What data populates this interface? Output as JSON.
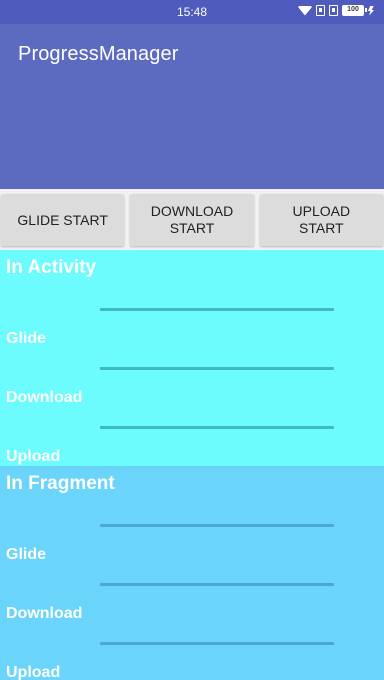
{
  "status_bar": {
    "time": "15:48",
    "battery": "100"
  },
  "app_bar": {
    "title": "ProgressManager"
  },
  "buttons": {
    "glide": "GLIDE START",
    "download": "DOWNLOAD\nSTART",
    "upload": "UPLOAD\nSTART"
  },
  "activity": {
    "title": "In Activity",
    "rows": [
      {
        "label": "Glide",
        "progress": 0
      },
      {
        "label": "Download",
        "progress": 0
      },
      {
        "label": "Upload",
        "progress": 0
      }
    ]
  },
  "fragment": {
    "title": "In Fragment",
    "rows": [
      {
        "label": "Glide",
        "progress": 0
      },
      {
        "label": "Download",
        "progress": 0
      },
      {
        "label": "Upload",
        "progress": 0
      }
    ]
  },
  "colors": {
    "app_bar": "#5c6bc0",
    "status_bar": "#4f5bbd",
    "activity_bg": "#6cfcfe",
    "fragment_bg": "#6ad4fb"
  }
}
